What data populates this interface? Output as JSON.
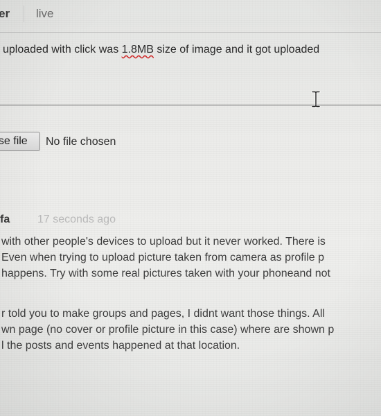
{
  "tabs": [
    {
      "label": "er"
    },
    {
      "label": "live"
    }
  ],
  "composer": {
    "text_before": "uploaded with click was ",
    "text_flagged": "1.8MB",
    "text_after": " size of image and it got uploaded"
  },
  "file_input": {
    "button_label": "ose file",
    "status": "No file chosen"
  },
  "comment": {
    "author": "fa",
    "timestamp": "17 seconds ago",
    "lines": [
      "with other people's devices to upload but it never worked. There is",
      "Even when trying to upload picture taken from camera as profile p",
      "happens. Try with some real pictures taken with your phoneand not",
      "r told you to make groups and pages, I didnt want those things. All",
      "wn page (no cover or profile picture in this case) where are shown p",
      "l the posts and events happened at that location."
    ]
  },
  "icons": {
    "text_cursor": "i-beam-cursor-icon"
  },
  "colors": {
    "spell_error": "#d03030",
    "timestamp": "#b9b9b9"
  }
}
